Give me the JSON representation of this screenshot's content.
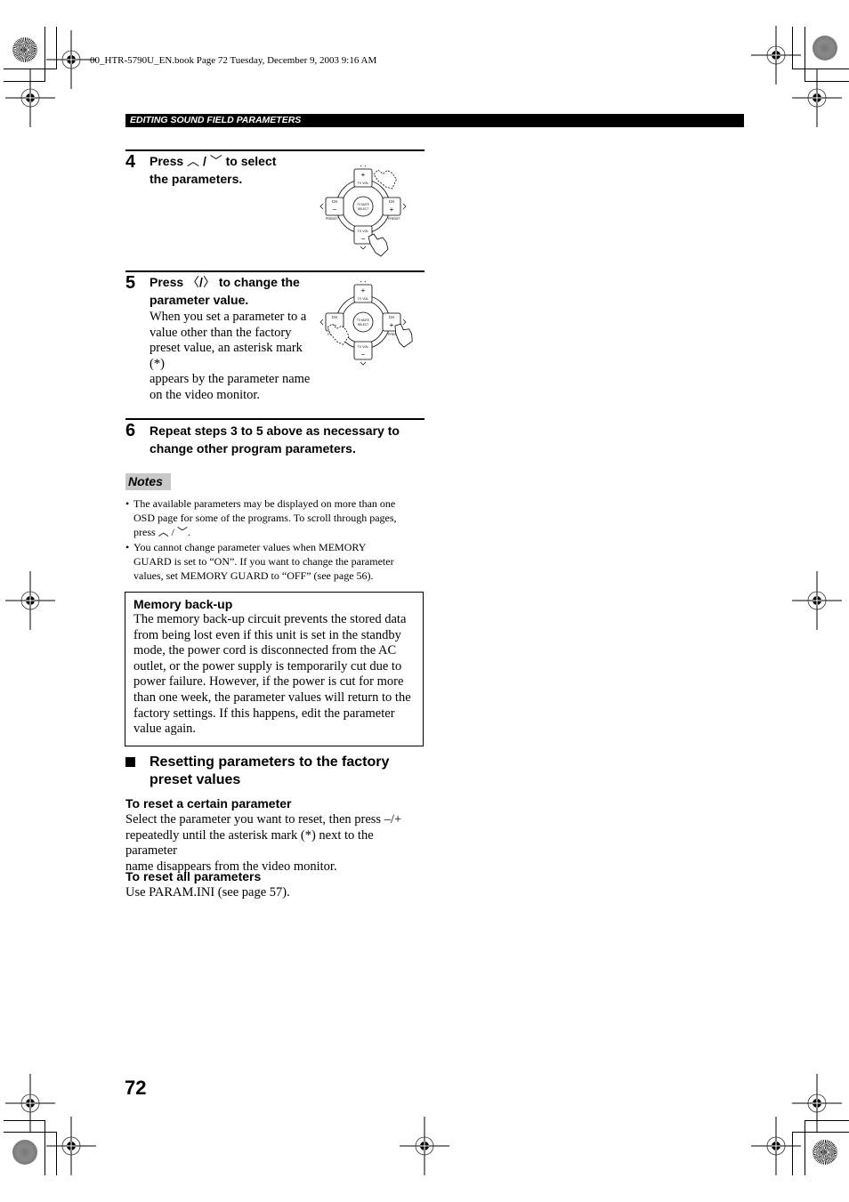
{
  "print_header": {
    "info_line": "00_HTR-5790U_EN.book  Page 72  Tuesday, December 9, 2003  9:16 AM"
  },
  "section_bar": "EDITING SOUND FIELD PARAMETERS",
  "steps": [
    {
      "number": "4",
      "title_pre": "Press",
      "title_sym_1": "︿",
      "title_sep": "/",
      "title_sym_2": "﹀",
      "title_post": "to select",
      "title_line2": "the parameters.",
      "illustration": {
        "highlighted_button": "TV VOL −",
        "labels": {
          "top": "TV VOL",
          "top_sign": "+",
          "bottom": "TV VOL",
          "bottom_sign": "−",
          "left": "CH",
          "left_sign": "−",
          "right": "CH",
          "right_sign": "+",
          "center_1": "TV MUTE",
          "center_2": "SELECT",
          "preset_left": "PRESET",
          "preset_right": "PRESET"
        }
      }
    },
    {
      "number": "5",
      "title_pre": "Press",
      "title_sym_1": "〈",
      "title_sep": "/",
      "title_sym_2": "〉",
      "title_post": "to change the",
      "title_line2": "parameter value.",
      "body_lines": [
        "When you set a parameter to a",
        "value other than the factory",
        "preset value, an asterisk mark",
        "(*)",
        "appears by the parameter name",
        "on the video monitor."
      ],
      "illustration": {
        "highlighted_button": "CH +",
        "labels": {
          "top": "TV VOL",
          "top_sign": "+",
          "bottom": "TV VOL",
          "bottom_sign": "−",
          "left": "CH",
          "left_sign": "−",
          "right": "CH",
          "right_sign": "+",
          "center_1": "TV MUTE",
          "center_2": "SELECT",
          "preset_left": "PRES",
          "preset_right": "PRESET"
        }
      }
    },
    {
      "number": "6",
      "title_line1": "Repeat steps 3 to 5 above as necessary to",
      "title_line2": "change other program parameters."
    }
  ],
  "notes": {
    "label": "Notes",
    "items": [
      {
        "lines": [
          "The available parameters may be displayed on more than one",
          "OSD page for some of the programs. To scroll through pages,",
          "press ︿ / ﹀."
        ]
      },
      {
        "lines": [
          "You cannot change parameter values when MEMORY",
          "GUARD is set to “ON”. If you want to change the parameter",
          "values, set MEMORY GUARD to “OFF” (see page 56)."
        ]
      }
    ]
  },
  "memory_backup": {
    "title": "Memory back-up",
    "lines": [
      "The memory back-up circuit prevents the stored data",
      "from being lost even if this unit is set in the standby",
      "mode, the power cord is disconnected from the AC",
      "outlet, or the power supply is temporarily cut due to",
      "power failure. However, if the power is cut for more",
      "than one week, the parameter values will return to the",
      "factory settings. If this happens, edit the parameter",
      "value again."
    ]
  },
  "reset_section": {
    "title_line1": "Resetting parameters to the factory",
    "title_line2": "preset values",
    "certain": {
      "title": "To reset a certain parameter",
      "lines": [
        "Select the parameter you want to reset, then press –/+",
        "repeatedly until the asterisk mark (*) next to the parameter",
        "name disappears from the video monitor."
      ]
    },
    "all": {
      "title": "To reset all parameters",
      "line": "Use PARAM.INI (see page 57)."
    }
  },
  "page_number": "72"
}
